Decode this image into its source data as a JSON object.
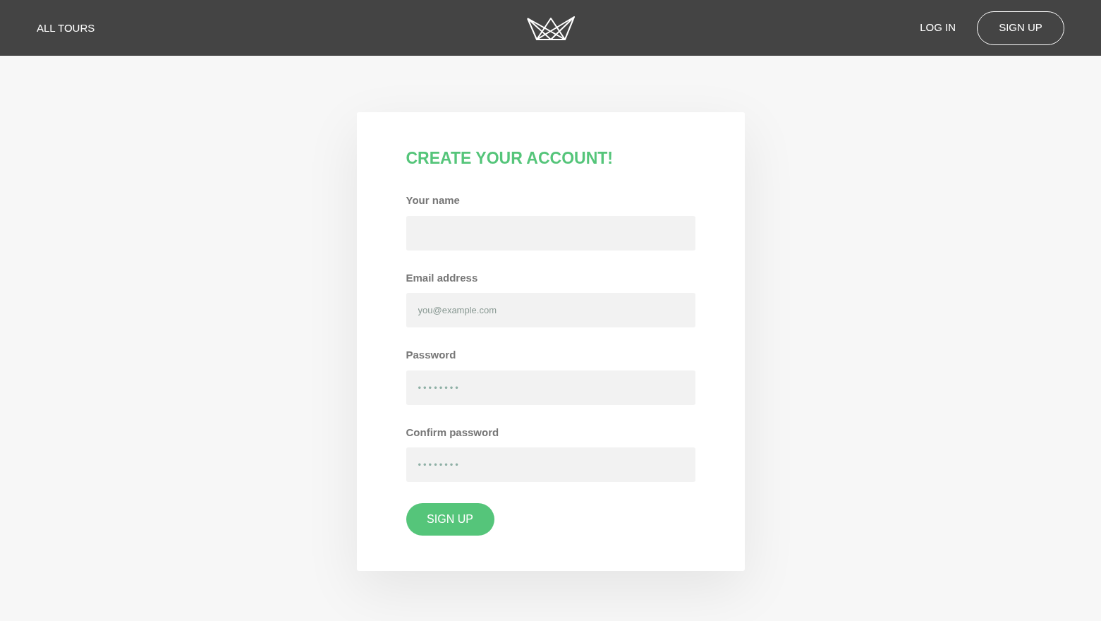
{
  "header": {
    "nav_link": "ALL TOURS",
    "login": "LOG IN",
    "signup": "SIGN UP"
  },
  "form": {
    "title": "CREATE YOUR ACCOUNT!",
    "fields": [
      {
        "label": "Your name",
        "kind": "text"
      },
      {
        "label": "Email address",
        "kind": "email",
        "placeholder": "you@example.com"
      },
      {
        "label": "Password",
        "kind": "password",
        "placeholder": "••••••••"
      },
      {
        "label": "Confirm password",
        "kind": "password",
        "placeholder": "••••••••"
      }
    ],
    "submit": "SIGN UP"
  }
}
